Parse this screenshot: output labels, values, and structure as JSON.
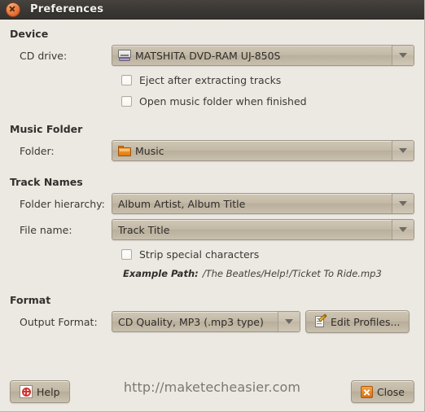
{
  "window": {
    "title": "Preferences",
    "close_icon": "window-close-icon"
  },
  "sections": {
    "device": {
      "title": "Device",
      "cd_drive_label": "CD drive:",
      "cd_drive_value": "MATSHITA DVD-RAM UJ-850S",
      "cd_drive_icon": "cd-drive-icon",
      "eject_label": "Eject after extracting tracks",
      "eject_checked": false,
      "open_folder_label": "Open music folder when finished",
      "open_folder_checked": false
    },
    "music_folder": {
      "title": "Music Folder",
      "folder_label": "Folder:",
      "folder_value": "Music",
      "folder_icon": "folder-icon"
    },
    "track_names": {
      "title": "Track Names",
      "hierarchy_label": "Folder hierarchy:",
      "hierarchy_value": "Album Artist, Album Title",
      "filename_label": "File name:",
      "filename_value": "Track Title",
      "strip_label": "Strip special characters",
      "strip_checked": false,
      "example_label": "Example Path:",
      "example_value": "/The Beatles/Help!/Ticket To Ride.mp3"
    },
    "format": {
      "title": "Format",
      "output_label": "Output Format:",
      "output_value": "CD Quality, MP3 (.mp3 type)",
      "edit_profiles_label": "Edit Profiles...",
      "edit_profiles_icon": "edit-document-icon"
    }
  },
  "footer": {
    "help_label": "Help",
    "help_icon": "life-ring-icon",
    "close_label": "Close",
    "close_icon": "close-x-icon",
    "watermark": "http://maketecheasier.com"
  },
  "colors": {
    "window_bg": "#ece9e2",
    "titlebar_bg": "#3b3835",
    "accent_orange": "#e8892a",
    "control_bg": "#c3b9a6",
    "text": "#3b3935"
  }
}
